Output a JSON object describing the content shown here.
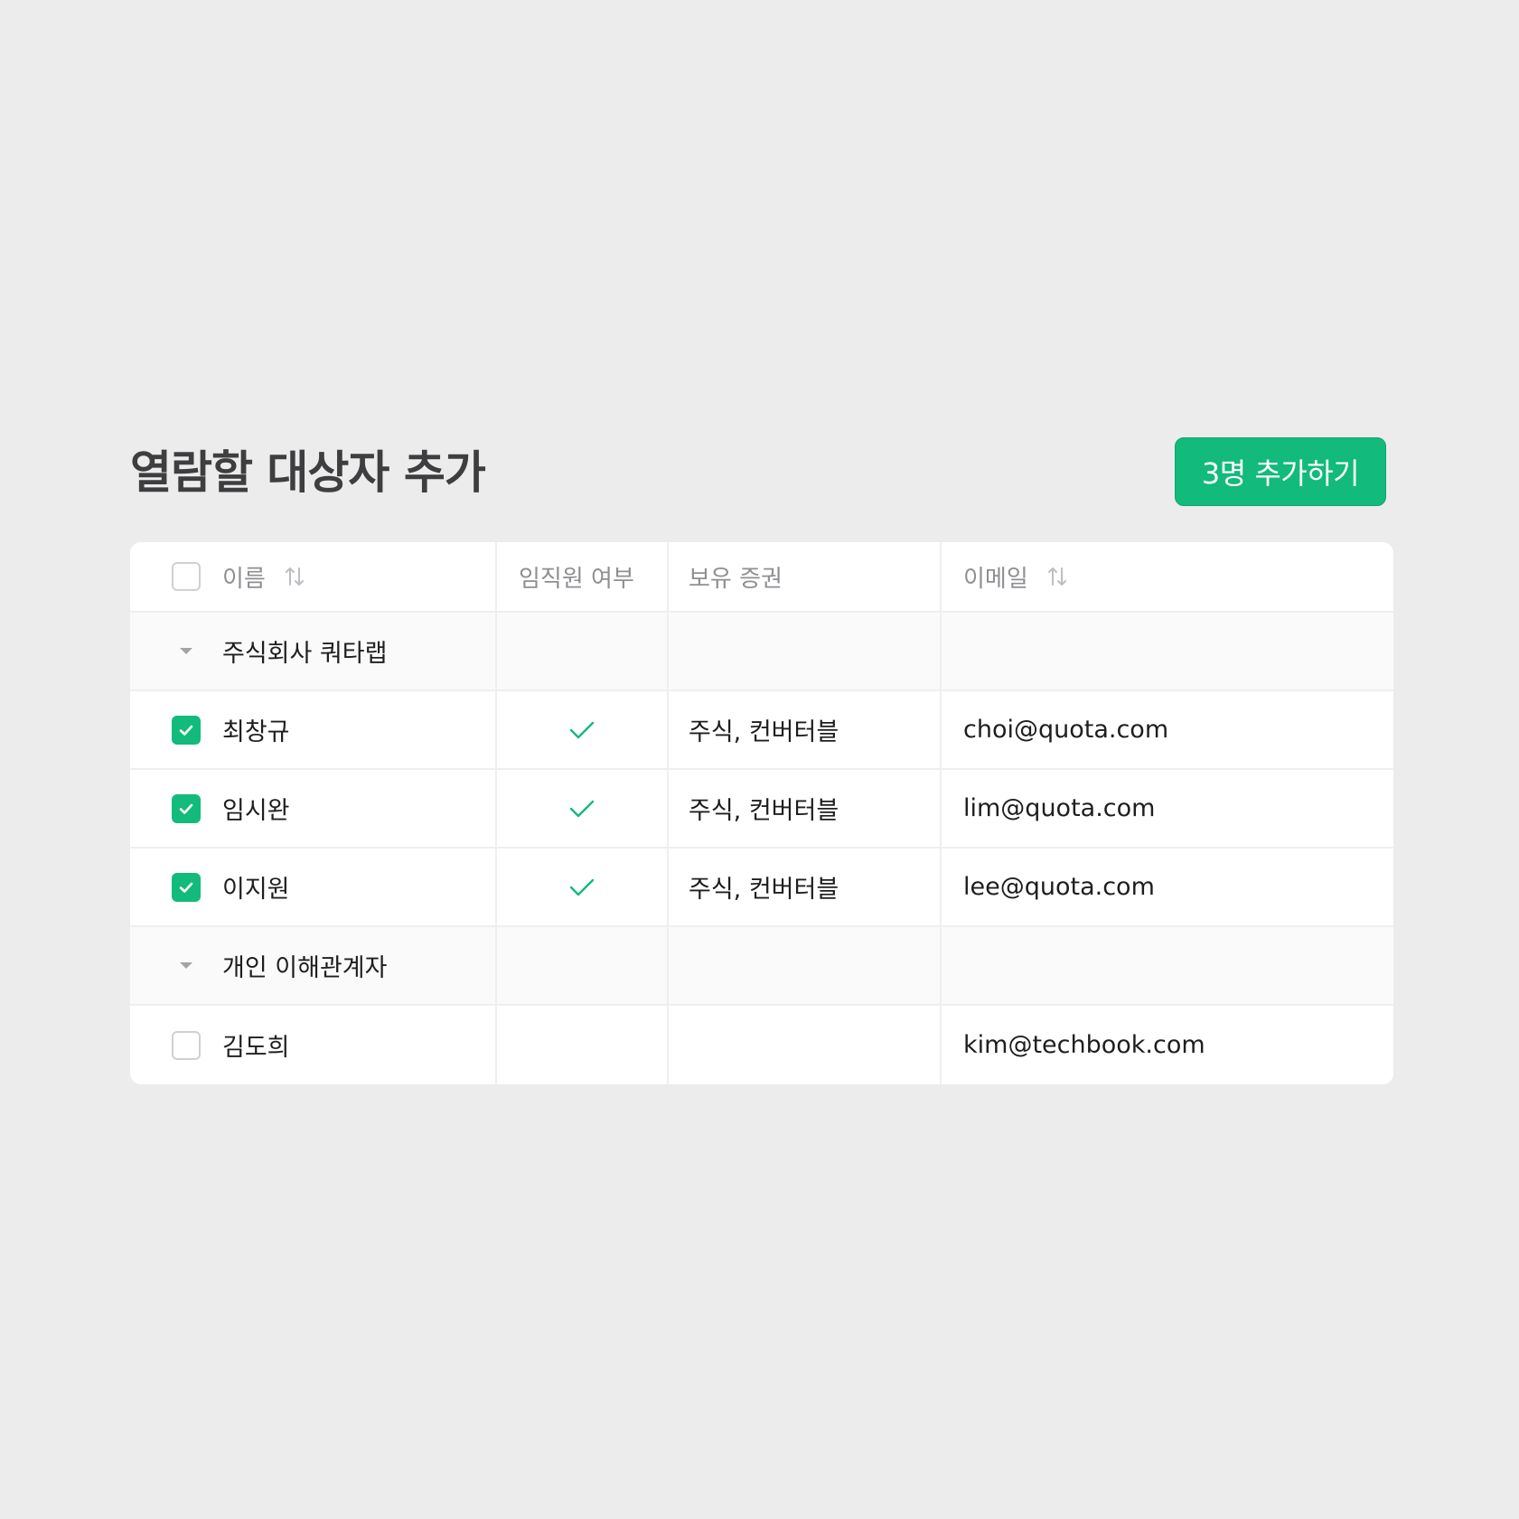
{
  "page": {
    "title": "열람할 대상자 추가"
  },
  "actions": {
    "add_button": "3명 추가하기"
  },
  "colors": {
    "accent": "#12BA7C",
    "background": "#ECECEC",
    "header_text": "#8E8F93"
  },
  "table": {
    "columns": [
      "이름",
      "임직원 여부",
      "보유 증권",
      "이메일"
    ],
    "sortable_columns": [
      "이름",
      "이메일"
    ],
    "groups": [
      {
        "name": "주식회사 쿼타랩",
        "rows": [
          {
            "checked": true,
            "name": "최창규",
            "employee": true,
            "securities": "주식, 컨버터블",
            "email": "choi@quota.com"
          },
          {
            "checked": true,
            "name": "임시완",
            "employee": true,
            "securities": "주식, 컨버터블",
            "email": "lim@quota.com"
          },
          {
            "checked": true,
            "name": "이지원",
            "employee": true,
            "securities": "주식, 컨버터블",
            "email": "lee@quota.com"
          }
        ]
      },
      {
        "name": "개인 이해관계자",
        "rows": [
          {
            "checked": false,
            "name": "김도희",
            "employee": false,
            "securities": "",
            "email": "kim@techbook.com"
          }
        ]
      }
    ]
  }
}
